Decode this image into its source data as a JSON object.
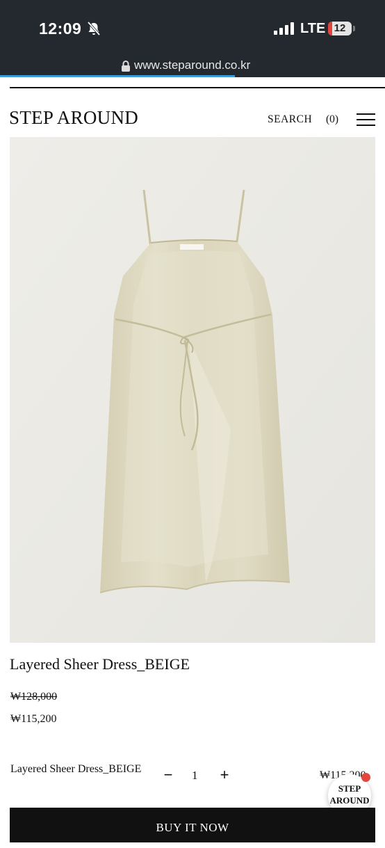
{
  "status_bar": {
    "time": "12:09",
    "network": "LTE",
    "battery": "12"
  },
  "browser": {
    "url": "www.steparound.co.kr",
    "load_progress": 0.61
  },
  "header": {
    "brand": "STEP AROUND",
    "search_label": "SEARCH",
    "cart_label": "(0)"
  },
  "product": {
    "name": "Layered Sheer Dress_BEIGE",
    "original_price": "₩128,000",
    "sale_price": "₩115,200",
    "tag_text": "STEP AROUND"
  },
  "option": {
    "name": "Layered Sheer Dress_BEIGE",
    "minus": "−",
    "quantity": "1",
    "plus": "+",
    "price": "₩115,200"
  },
  "badge": {
    "label_line1": "STEP",
    "label_line2": "AROUND"
  },
  "buy_button": {
    "label": "BUY IT NOW"
  },
  "colors": {
    "status_bar_bg": "#24292f",
    "progress": "#3a9bd8",
    "photo_bg": "#ebeae5",
    "dress": "#d9d4ba",
    "buy_bg": "#111111",
    "badge_dot": "#e4463d"
  },
  "icons": [
    "bell-muted-icon",
    "signal-icon",
    "battery-icon",
    "lock-icon",
    "menu-icon"
  ]
}
